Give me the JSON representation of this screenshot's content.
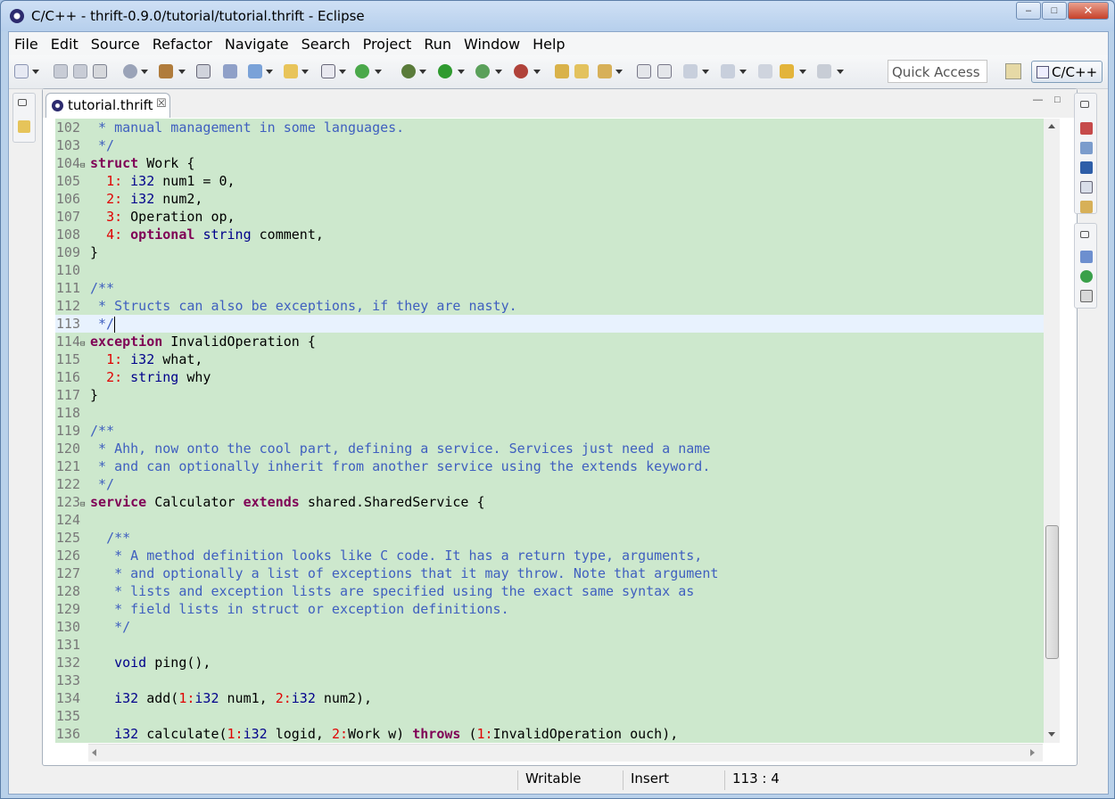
{
  "window": {
    "title": "C/C++ - thrift-0.9.0/tutorial/tutorial.thrift - Eclipse",
    "minimize_label": "–",
    "maximize_label": "□",
    "close_label": "✕"
  },
  "menu": [
    "File",
    "Edit",
    "Source",
    "Refactor",
    "Navigate",
    "Search",
    "Project",
    "Run",
    "Window",
    "Help"
  ],
  "toolbar": {
    "quick_access_placeholder": "Quick Access",
    "perspective_label": "C/C++"
  },
  "editor": {
    "tab_label": "tutorial.thrift",
    "tab_close": "☒",
    "minimize_glyph": "—",
    "maximize_glyph": "□",
    "lines": [
      {
        "n": "102",
        "html": "<span class='c'> * manual management in some languages.</span>"
      },
      {
        "n": "103",
        "html": "<span class='c'> */</span>"
      },
      {
        "n": "104",
        "fold": true,
        "html": "<span class='k'>struct</span> Work {"
      },
      {
        "n": "105",
        "html": "  <span class='n'>1:</span> <span class='t'>i32</span> num1 = 0,"
      },
      {
        "n": "106",
        "html": "  <span class='n'>2:</span> <span class='t'>i32</span> num2,"
      },
      {
        "n": "107",
        "html": "  <span class='n'>3:</span> Operation op,"
      },
      {
        "n": "108",
        "html": "  <span class='n'>4:</span> <span class='k'>optional</span> <span class='t'>string</span> comment,"
      },
      {
        "n": "109",
        "html": "}"
      },
      {
        "n": "110",
        "html": ""
      },
      {
        "n": "111",
        "html": "<span class='c'>/**</span>"
      },
      {
        "n": "112",
        "html": "<span class='c'> * Structs can also be exceptions, if they are nasty.</span>"
      },
      {
        "n": "113",
        "current": true,
        "html": "<span class='c'> */</span><span class='caret'></span>"
      },
      {
        "n": "114",
        "fold": true,
        "html": "<span class='k'>exception</span> InvalidOperation {"
      },
      {
        "n": "115",
        "html": "  <span class='n'>1:</span> <span class='t'>i32</span> what,"
      },
      {
        "n": "116",
        "html": "  <span class='n'>2:</span> <span class='t'>string</span> why"
      },
      {
        "n": "117",
        "html": "}"
      },
      {
        "n": "118",
        "html": ""
      },
      {
        "n": "119",
        "html": "<span class='c'>/**</span>"
      },
      {
        "n": "120",
        "html": "<span class='c'> * Ahh, now onto the cool part, defining a service. Services just need a name</span>"
      },
      {
        "n": "121",
        "html": "<span class='c'> * and can optionally inherit from another service using the extends keyword.</span>"
      },
      {
        "n": "122",
        "html": "<span class='c'> */</span>"
      },
      {
        "n": "123",
        "fold": true,
        "html": "<span class='k'>service</span> Calculator <span class='k'>extends</span> shared.SharedService {"
      },
      {
        "n": "124",
        "html": ""
      },
      {
        "n": "125",
        "html": "  <span class='c'>/**</span>"
      },
      {
        "n": "126",
        "html": "<span class='c'>   * A method definition looks like C code. It has a return type, arguments,</span>"
      },
      {
        "n": "127",
        "html": "<span class='c'>   * and optionally a list of exceptions that it may throw. Note that argument</span>"
      },
      {
        "n": "128",
        "html": "<span class='c'>   * lists and exception lists are specified using the exact same syntax as</span>"
      },
      {
        "n": "129",
        "html": "<span class='c'>   * field lists in struct or exception definitions.</span>"
      },
      {
        "n": "130",
        "html": "<span class='c'>   */</span>"
      },
      {
        "n": "131",
        "html": ""
      },
      {
        "n": "132",
        "html": "   <span class='t'>void</span> ping(),"
      },
      {
        "n": "133",
        "html": ""
      },
      {
        "n": "134",
        "html": "   <span class='t'>i32</span> add(<span class='n'>1:</span><span class='t'>i32</span> num1, <span class='n'>2:</span><span class='t'>i32</span> num2),"
      },
      {
        "n": "135",
        "html": ""
      },
      {
        "n": "136",
        "html": "   <span class='t'>i32</span> calculate(<span class='n'>1:</span><span class='t'>i32</span> logid, <span class='n'>2:</span>Work w) <span class='k'>throws</span> (<span class='n'>1:</span>InvalidOperation ouch),"
      }
    ]
  },
  "status": {
    "writable": "Writable",
    "insert": "Insert",
    "position": "113 : 4"
  }
}
